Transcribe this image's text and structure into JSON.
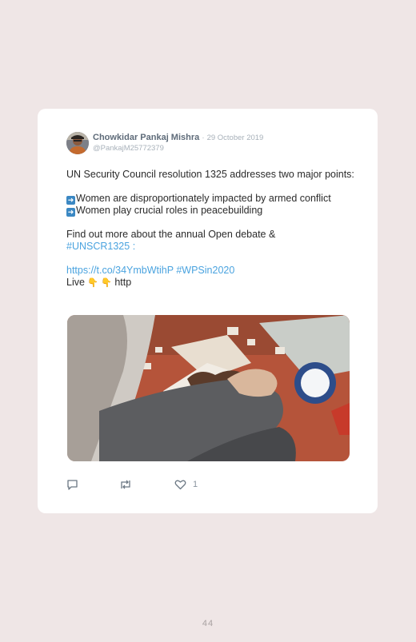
{
  "tweet": {
    "author_name": "Chowkidar Pankaj Mishra",
    "separator": "·",
    "date": "29 October 2019",
    "handle": "@PankajM25772379",
    "line1": "UN Security Council resolution 1325 addresses two major points:",
    "bullet1": "Women are disproportionately impacted by armed conflict",
    "bullet2": "Women play crucial roles in peacebuilding",
    "line2": "Find out more about the annual Open debate &",
    "hashtag1": "#UNSCR1325",
    "after_hashtag": " :",
    "url": "https://t.co/34YmbWtihP",
    "hashtag2": "#WPSin2020",
    "live_text": "Live",
    "emoji": "👇 👇",
    "http_text": " http",
    "like_count": "1",
    "image_alt": "Photo of a woman assembling a mosaic of a dove"
  },
  "icons": {
    "reply": "reply-icon",
    "retweet": "retweet-icon",
    "like": "heart-icon",
    "arrow": "right-arrow-emoji-icon"
  },
  "page": {
    "number": "44"
  },
  "colors": {
    "background": "#efe6e6",
    "link": "#4aa3df",
    "name": "#5e6b79"
  }
}
